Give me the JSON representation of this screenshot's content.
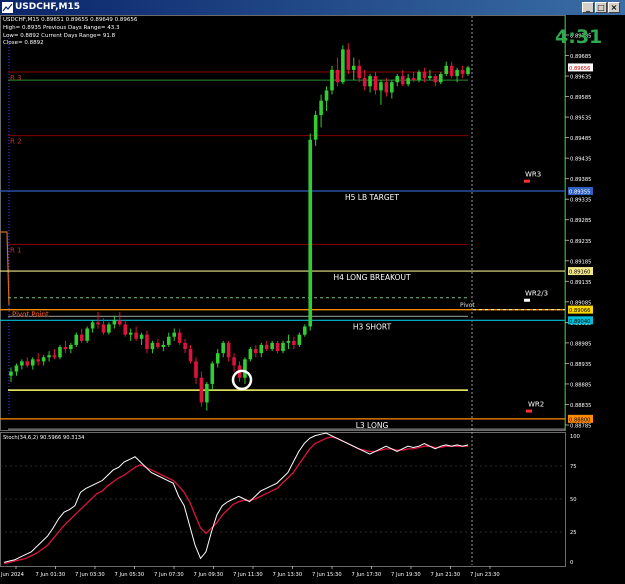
{
  "window": {
    "title": "USDCHF,M15",
    "buttons": [
      "_",
      "□",
      "×"
    ]
  },
  "info": {
    "ohlc": "USDCHF,M15  0.89651 0.89655 0.89649 0.89656",
    "line2": "High= 0.8935    Previous Days Range= 43.3",
    "line3": "Low= 0.8892    Current Days Range= 91.8",
    "line4": "Close= 0.8892"
  },
  "timer": "4:31",
  "price_axis": {
    "labels": [
      "0.89735",
      "0.89685",
      "0.89635",
      "0.89585",
      "0.89535",
      "0.89485",
      "0.89435",
      "0.89385",
      "0.89335",
      "0.89285",
      "0.89235",
      "0.89185",
      "0.89135",
      "0.89085",
      "0.89035",
      "0.88985",
      "0.88935",
      "0.88885",
      "0.88835",
      "0.88785"
    ],
    "markers": [
      {
        "text": "0.89656",
        "bg": "#ffffff",
        "fg": "#cc0000",
        "price": 0.89656
      },
      {
        "text": "0.89355",
        "bg": "#3060c0",
        "fg": "#ffffff",
        "price": 0.89355
      },
      {
        "text": "0.89160",
        "bg": "#f0e68c",
        "fg": "#000000",
        "price": 0.8916
      },
      {
        "text": "0.89066",
        "bg": "#ffd700",
        "fg": "#000000",
        "price": 0.89066
      },
      {
        "text": "0.89040",
        "bg": "#00bcd4",
        "fg": "#000000",
        "price": 0.8904
      },
      {
        "text": "0.88800",
        "bg": "#ff8c00",
        "fg": "#000000",
        "price": 0.888
      }
    ]
  },
  "levels": [
    {
      "label": "R 3",
      "price": 0.89645,
      "color": "#8b0000"
    },
    {
      "label": "R 2",
      "price": 0.8949,
      "color": "#8b0000"
    },
    {
      "label": "R 1",
      "price": 0.89225,
      "color": "#8b0000"
    },
    {
      "label": "Pivot Point",
      "price": 0.89066,
      "color": "#ff8c00"
    },
    {
      "label": "H5 LB TARGET",
      "price": 0.89355,
      "color": "#3060c0"
    },
    {
      "label": "H4 LONG BREAKOUT",
      "price": 0.8916,
      "color": "#f0e68c"
    },
    {
      "label": "H3 SHORT",
      "price": 0.8904,
      "color": "#00bcd4"
    },
    {
      "label": "L3 LONG",
      "price": 0.888,
      "color": "#ff8c00"
    },
    {
      "label": "WR3",
      "price": 0.89385,
      "color": "#ff4040"
    },
    {
      "label": "WR2/3",
      "price": 0.89095,
      "color": "#ffffff"
    },
    {
      "label": "WR2",
      "price": 0.88825,
      "color": "#ff4040"
    },
    {
      "label": "Pivot",
      "price": 0.89075,
      "color": "#ffffff"
    }
  ],
  "stoch": {
    "title": "Stoch(34,6,2) 90.5966 90.3134",
    "scale": [
      "100",
      "75",
      "50",
      "25",
      "0"
    ]
  },
  "time_axis": {
    "labels": [
      "7 Jun 2024",
      "7 Jun 01:30",
      "7 Jun 03:30",
      "7 Jun 05:30",
      "7 Jun 07:30",
      "7 Jun 09:30",
      "7 Jun 11:30",
      "7 Jun 13:30",
      "7 Jun 15:30",
      "7 Jun 17:30",
      "7 Jun 19:30",
      "7 Jun 21:30",
      "7 Jun 23:30"
    ]
  },
  "colors": {
    "bull": "#32cd32",
    "bear": "#dc143c",
    "stoch_main": "#ffffff",
    "stoch_signal": "#dc143c"
  }
}
